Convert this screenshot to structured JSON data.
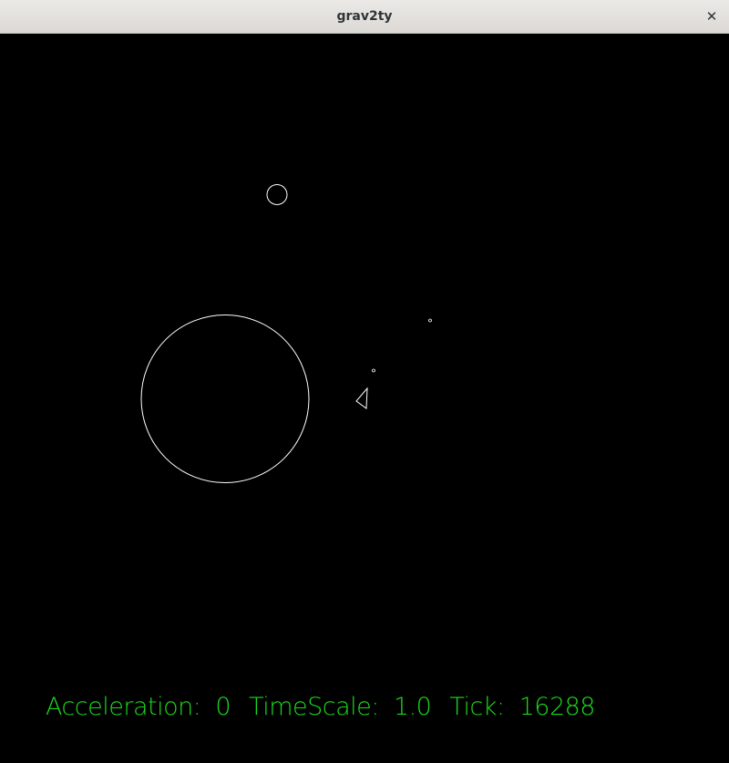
{
  "window": {
    "title": "grav2ty",
    "close_glyph": "✕"
  },
  "scene": {
    "background": "#000000",
    "stroke_color": "#ffffff",
    "objects": [
      {
        "kind": "planet",
        "label": "large-planet"
      },
      {
        "kind": "planet",
        "label": "small-planet"
      },
      {
        "kind": "particle",
        "label": "particle-1"
      },
      {
        "kind": "particle",
        "label": "particle-2"
      },
      {
        "kind": "ship",
        "label": "ship"
      }
    ]
  },
  "hud": {
    "color": "#1ed81e",
    "acceleration_label": "Acceleration:",
    "acceleration_value": "0",
    "timescale_label": "TimeScale:",
    "timescale_value": "1.0",
    "tick_label": "Tick:",
    "tick_value": "16288"
  }
}
